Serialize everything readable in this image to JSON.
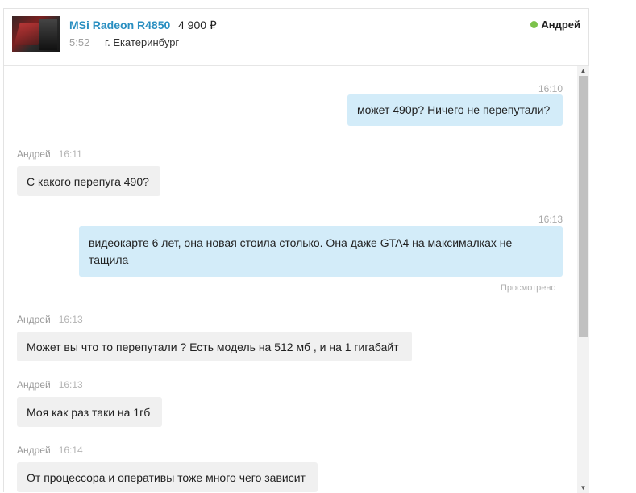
{
  "header": {
    "title": "MSi Radeon R4850",
    "price": "4 900 ₽",
    "time": "5:52",
    "city": "г. Екатеринбург",
    "user": "Андрей",
    "online_color": "#7cc24b"
  },
  "messages": [
    {
      "dir": "out",
      "time": "16:10",
      "text": "может 490р? Ничего не перепутали?"
    },
    {
      "dir": "in",
      "author": "Андрей",
      "time": "16:11",
      "text": "С какого перепуга 490?"
    },
    {
      "dir": "out",
      "time": "16:13",
      "text": "видеокарте 6 лет, она новая стоила столько. Она даже GTA4 на максималках не тащила",
      "status": "Просмотрено"
    },
    {
      "dir": "in",
      "author": "Андрей",
      "time": "16:13",
      "text": "Может вы что то перепутали ? Есть модель на 512 мб , и на 1 гигабайт"
    },
    {
      "dir": "in",
      "author": "Андрей",
      "time": "16:13",
      "text": "Моя как раз таки на 1гб"
    },
    {
      "dir": "in",
      "author": "Андрей",
      "time": "16:14",
      "text": "От процессора и оперативы тоже много чего зависит"
    }
  ],
  "scrollbar": {
    "up_icon": "▲",
    "down_icon": "▼"
  }
}
